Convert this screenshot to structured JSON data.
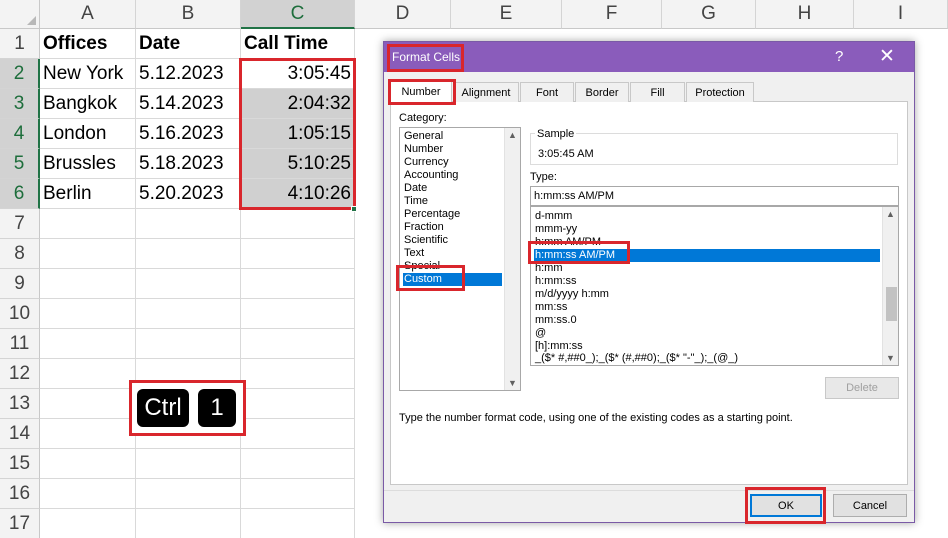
{
  "sheet": {
    "columns": [
      "A",
      "B",
      "C",
      "D",
      "E",
      "F",
      "G",
      "H",
      "I"
    ],
    "rows": [
      "1",
      "2",
      "3",
      "4",
      "5",
      "6",
      "7",
      "8",
      "9",
      "10",
      "11",
      "12",
      "13",
      "14",
      "15",
      "16",
      "17"
    ],
    "headers": [
      "Offices",
      "Date",
      "Call Time"
    ],
    "data": [
      [
        "New York",
        "5.12.2023",
        "3:05:45"
      ],
      [
        "Bangkok",
        "5.14.2023",
        "2:04:32"
      ],
      [
        "London",
        "5.16.2023",
        "1:05:15"
      ],
      [
        "Brussles",
        "5.18.2023",
        "5:10:25"
      ],
      [
        "Berlin",
        "5.20.2023",
        "4:10:26"
      ]
    ]
  },
  "shortcut": {
    "keys": [
      "Ctrl",
      "1"
    ]
  },
  "dialog": {
    "title": "Format Cells",
    "help": "?",
    "close": "✕",
    "tabs": [
      "Number",
      "Alignment",
      "Font",
      "Border",
      "Fill",
      "Protection"
    ],
    "category_label": "Category:",
    "categories": [
      "General",
      "Number",
      "Currency",
      "Accounting",
      "Date",
      "Time",
      "Percentage",
      "Fraction",
      "Scientific",
      "Text",
      "Special",
      "Custom"
    ],
    "selected_category": "Custom",
    "sample_label": "Sample",
    "sample_value": "3:05:45 AM",
    "type_label": "Type:",
    "type_value": "h:mm:ss AM/PM",
    "types": [
      "d-mmm",
      "mmm-yy",
      "h:mm AM/PM",
      "h:mm:ss AM/PM",
      "h:mm",
      "h:mm:ss",
      "m/d/yyyy h:mm",
      "mm:ss",
      "mm:ss.0",
      "@",
      "[h]:mm:ss",
      "_($* #,##0_);_($* (#,##0);_($* \"-\"_);_(@_)"
    ],
    "selected_type": "h:mm:ss AM/PM",
    "delete_label": "Delete",
    "hint": "Type the number format code, using one of the existing codes as a starting point.",
    "ok_label": "OK",
    "cancel_label": "Cancel"
  },
  "colors": {
    "excel_green": "#217346",
    "title_purple": "#8a5cbb",
    "highlight_red": "#d9262c",
    "selection_blue": "#0078d7"
  },
  "icons": {
    "scroll_up": "scroll-up-arrow-icon",
    "scroll_down": "scroll-down-arrow-icon"
  }
}
